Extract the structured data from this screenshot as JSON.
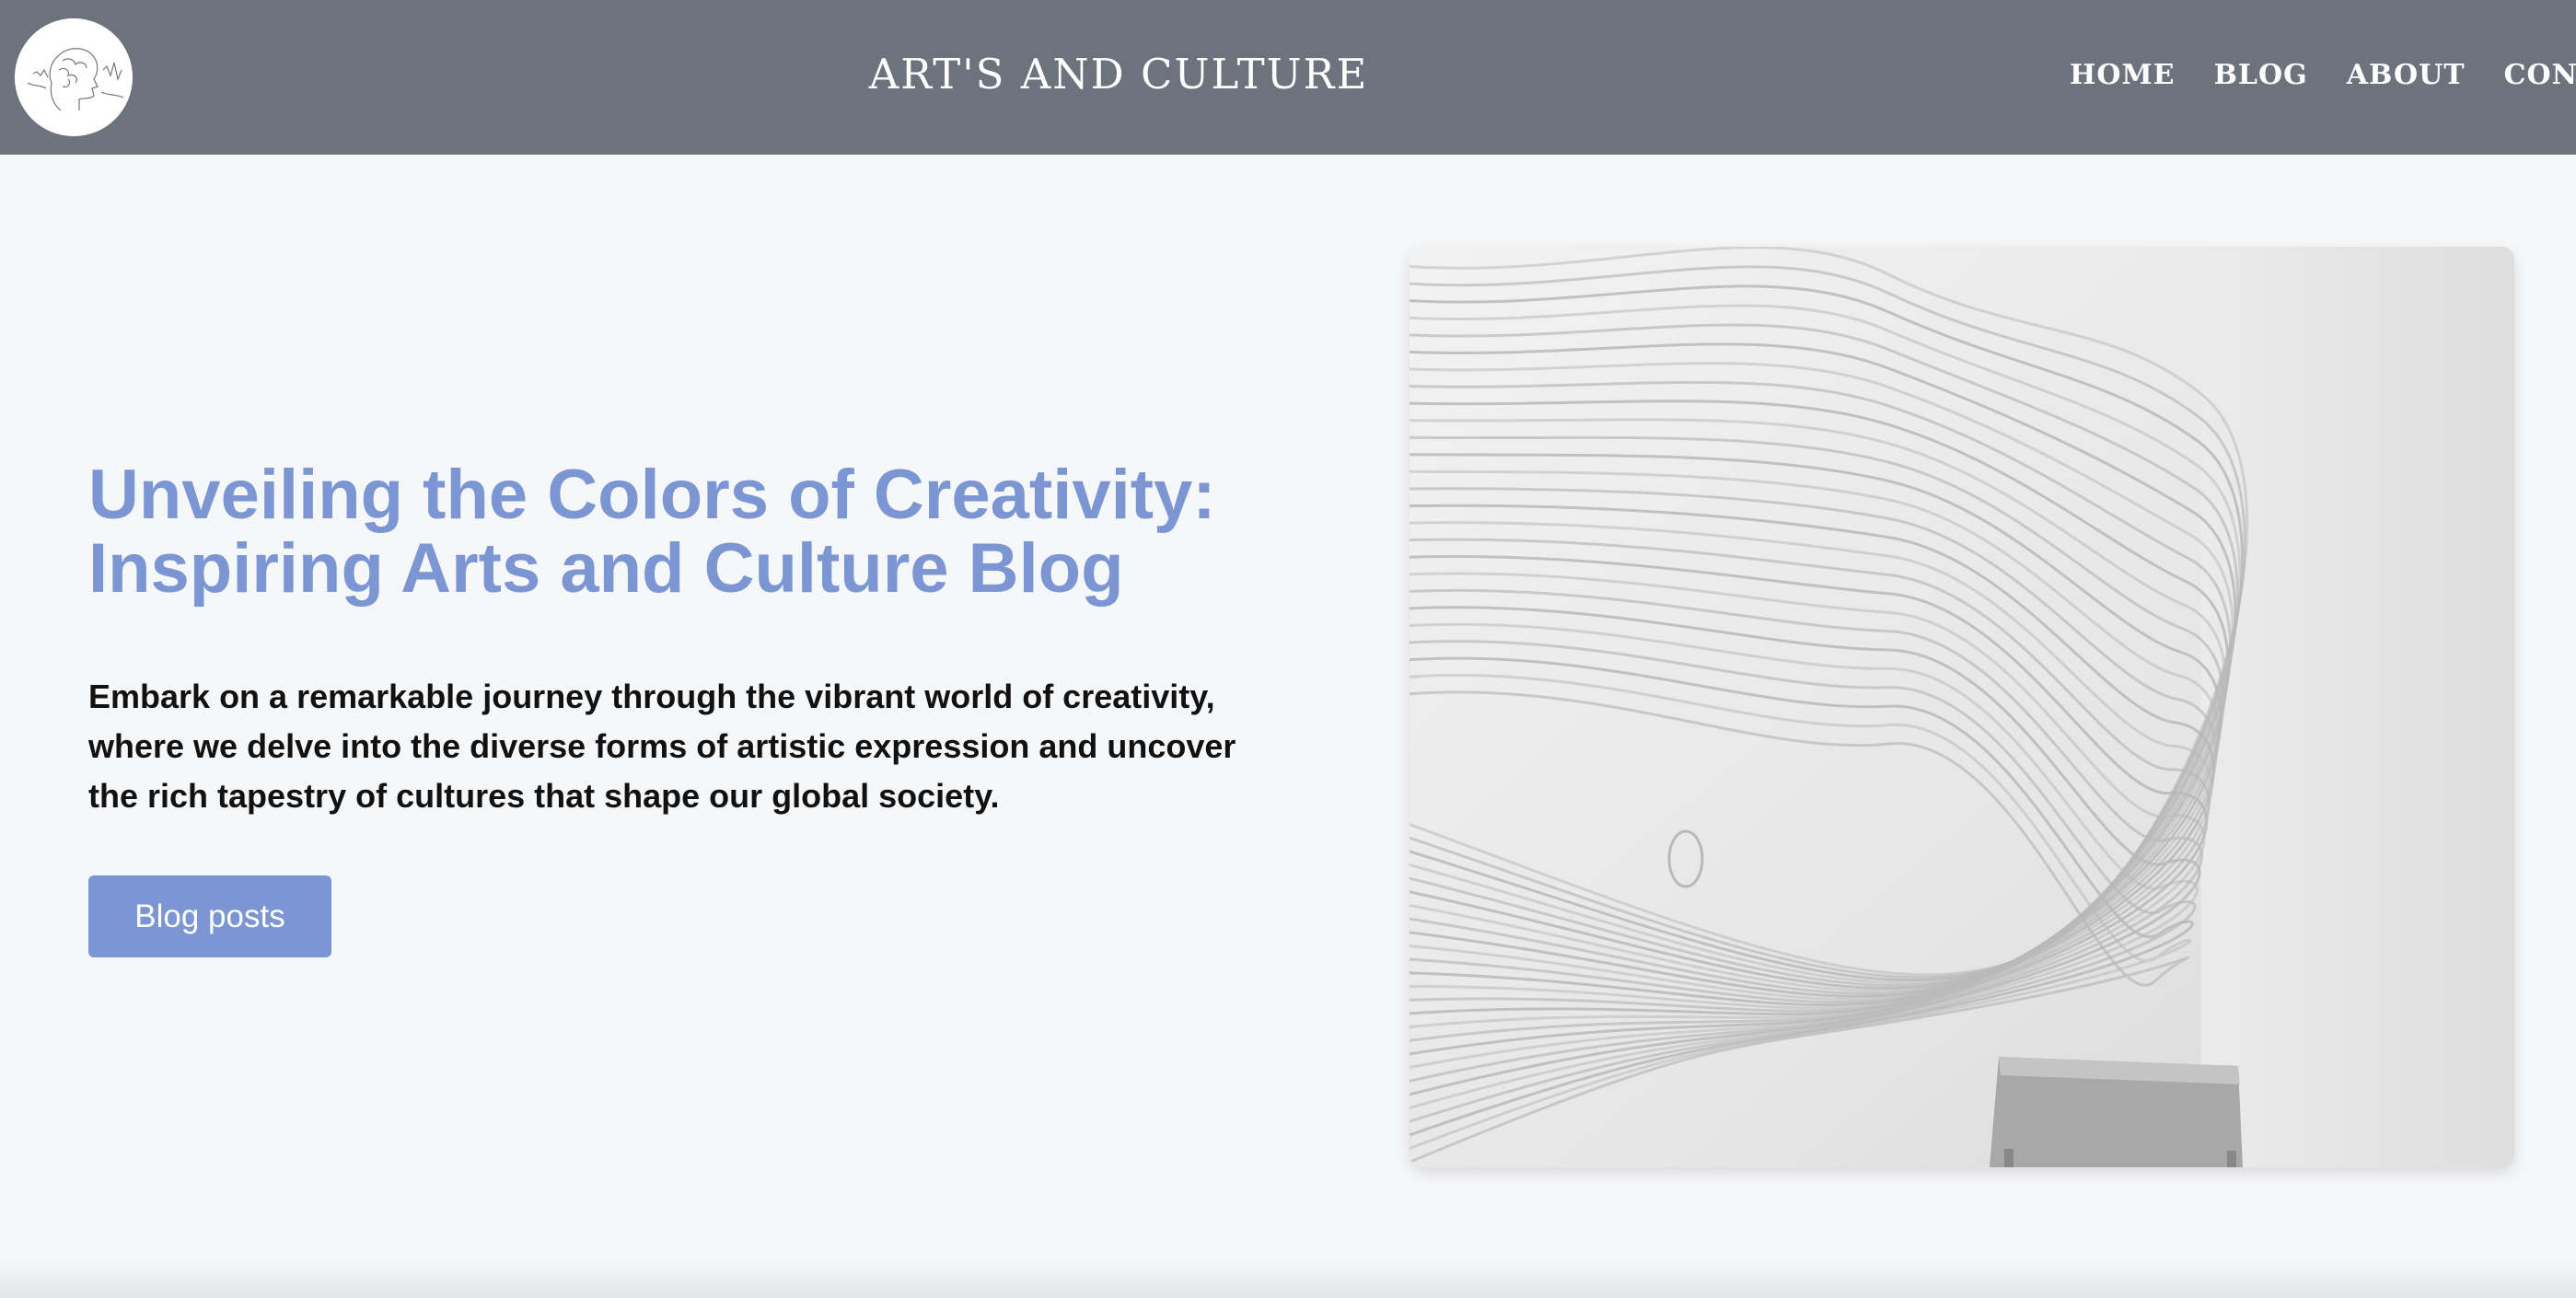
{
  "header": {
    "site_title": "ART'S AND CULTURE",
    "logo_icon": "brain-profile-logo-icon",
    "background_color": "#6c737c",
    "nav": [
      {
        "label": "HOME"
      },
      {
        "label": "BLOG"
      },
      {
        "label": "ABOUT"
      },
      {
        "label": "CONTACT"
      }
    ]
  },
  "hero": {
    "title_lines": [
      "Unveiling the Colors of Creativity:",
      "Inspiring Arts and Culture Blog"
    ],
    "description_lines": [
      "Embark on a remarkable journey through the vibrant world of creativity,",
      "where we delve into the diverse forms of artistic expression and uncover",
      "the rich tapestry of cultures that shape our global society."
    ],
    "cta_label": "Blog posts",
    "image_icon": "topographic-wall-art-image",
    "accent_color": "#7b96d2"
  }
}
